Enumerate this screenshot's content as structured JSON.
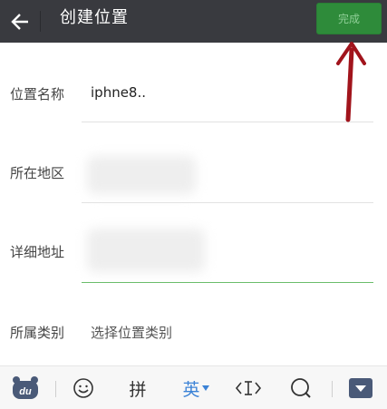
{
  "header": {
    "title": "创建位置",
    "done_label": "完成",
    "bar_color": "#393a3f",
    "done_color": "#2e8b3a"
  },
  "form": {
    "name": {
      "label": "位置名称",
      "value": "iphne8.."
    },
    "region": {
      "label": "所在地区"
    },
    "address": {
      "label": "详细地址"
    },
    "category": {
      "label": "所属类别",
      "placeholder": "选择位置类别"
    }
  },
  "keyboard": {
    "pinyin_label": "拼",
    "english_label": "英",
    "accent_color": "#3b82d6"
  },
  "annotation": {
    "arrow_color": "#a1141c"
  }
}
